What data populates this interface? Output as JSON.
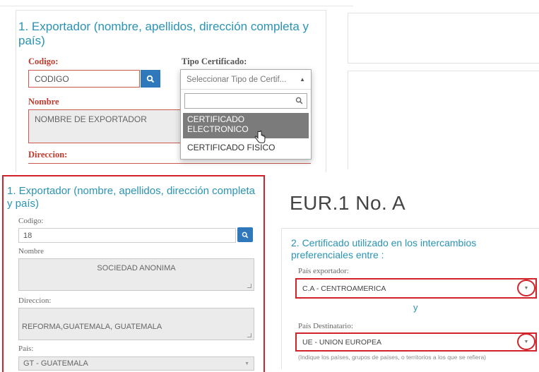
{
  "top": {
    "section_title": "1. Exportador (nombre, apellidos, dirección completa y país)",
    "codigo_label": "Codigo:",
    "codigo_value": "CODIGO",
    "tipo_label": "Tipo Certificado:",
    "tipo_placeholder": "Seleccionar Tipo de Certif...",
    "nombre_label": "Nombre",
    "nombre_value": "NOMBRE DE EXPORTADOR",
    "direccion_label": "Direccion:",
    "options": [
      {
        "label": "CERTIFICADO ELECTRONICO",
        "selected": true
      },
      {
        "label": "CERTIFICADO FISICO",
        "selected": false
      }
    ]
  },
  "left": {
    "section_title": "1. Exportador (nombre, apellidos, dirección completa y país)",
    "codigo_label": "Codigo:",
    "codigo_value": "18",
    "nombre_label": "Nombre",
    "nombre_value": "SOCIEDAD ANONIMA",
    "direccion_label": "Direccion:",
    "direccion_value": "REFORMA,GUATEMALA, GUATEMALA",
    "pais_label": "País:",
    "pais_value": "GT - GUATEMALA"
  },
  "right": {
    "eur_title": "EUR.1 No. A",
    "section_title": "2. Certificado utilizado en los intercambios preferenciales entre :",
    "exportador_label": "País exportador:",
    "exportador_value": "C.A - CENTROAMERICA",
    "connector": "y",
    "destinatario_label": "País Destinatario:",
    "destinatario_value": "UE - UNION EUROPEA",
    "hint": "(Indique los países, grupos de países, o territorios a los que se refiera)"
  },
  "colors": {
    "accent_title": "#2a93b5",
    "highlight_red": "#d2232a",
    "search_button": "#2e78bb",
    "selected_option": "#7b7b7b"
  }
}
